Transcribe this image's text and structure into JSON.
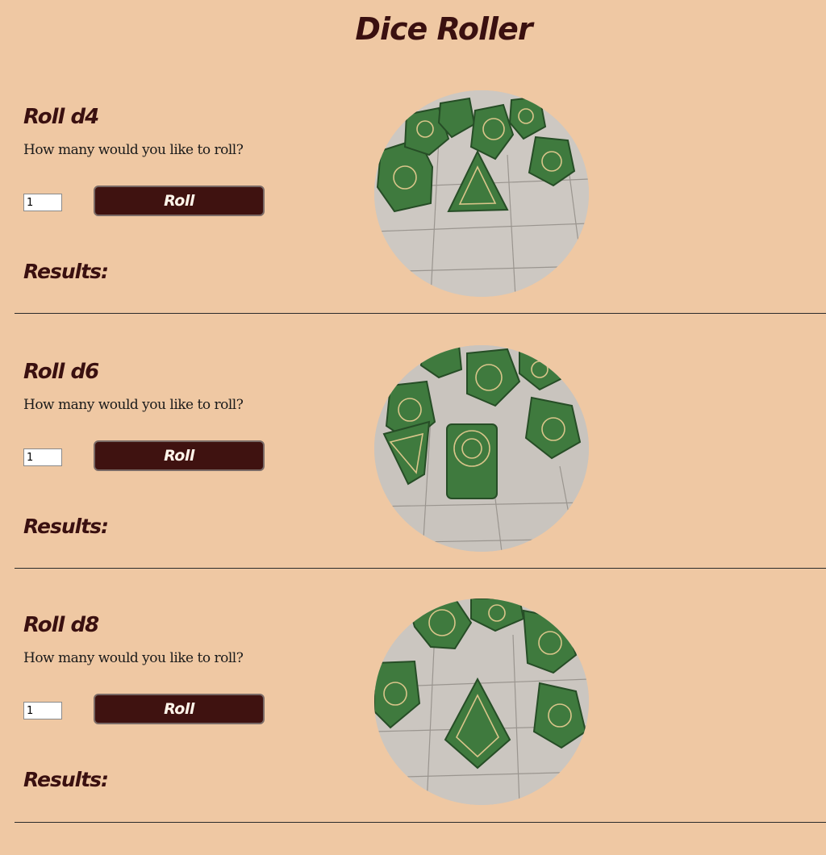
{
  "page": {
    "title": "Dice Roller"
  },
  "colors": {
    "background": "#efc8a3",
    "heading": "#3a1010",
    "button": "#3f1210",
    "button_text": "#fff5ea",
    "dice_green": "#3f7a3e",
    "dice_ink": "#d9c58a",
    "table_grey": "#c9c4be"
  },
  "sections": [
    {
      "heading": "Roll d4",
      "prompt": "How many would you like to roll?",
      "quantity": "1",
      "roll_label": "Roll",
      "results_label": "Results:",
      "photo_icon": "dice-photo-icon"
    },
    {
      "heading": "Roll d6",
      "prompt": "How many would you like to roll?",
      "quantity": "1",
      "roll_label": "Roll",
      "results_label": "Results:",
      "photo_icon": "dice-photo-icon"
    },
    {
      "heading": "Roll d8",
      "prompt": "How many would you like to roll?",
      "quantity": "1",
      "roll_label": "Roll",
      "results_label": "Results:",
      "photo_icon": "dice-photo-icon"
    }
  ]
}
